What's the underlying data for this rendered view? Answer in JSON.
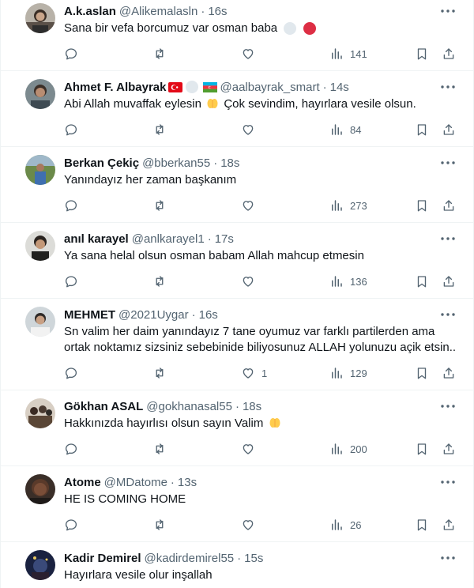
{
  "tweets": [
    {
      "name": "A.k.aslan",
      "handle": "@Alikemalasln",
      "time": "16s",
      "text": "Sana bir vefa borcumuz var osman baba",
      "replies": "",
      "retweets": "",
      "likes": "",
      "views": "141"
    },
    {
      "name": "Ahmet F. Albayrak",
      "handle": "@aalbayrak_smart",
      "time": "14s",
      "text_before": "Abi Allah muvaffak eylesin",
      "text_after": "Çok sevindim, hayırlara vesile olsun.",
      "replies": "",
      "retweets": "",
      "likes": "",
      "views": "84"
    },
    {
      "name": "Berkan Çekiç",
      "handle": "@bberkan55",
      "time": "18s",
      "text": "Yanındayız her zaman başkanım",
      "replies": "",
      "retweets": "",
      "likes": "",
      "views": "273"
    },
    {
      "name": "anıl karayel",
      "handle": "@anlkarayel1",
      "time": "17s",
      "text": "Ya sana helal olsun osman babam Allah mahcup etmesin",
      "replies": "",
      "retweets": "",
      "likes": "",
      "views": "136"
    },
    {
      "name": "MEHMET",
      "handle": "@2021Uygar",
      "time": "16s",
      "text": "Sn valim her daim yanındayız 7 tane oyumuz var farklı partilerden ama ortak noktamız sizsiniz sebebinide biliyosunuz ALLAH yolunuzu açik etsin..",
      "replies": "",
      "retweets": "",
      "likes": "1",
      "views": "129"
    },
    {
      "name": "Gökhan ASAL",
      "handle": "@gokhanasal55",
      "time": "18s",
      "text": "Hakkınızda hayırlısı olsun sayın Valim",
      "replies": "",
      "retweets": "",
      "likes": "",
      "views": "200"
    },
    {
      "name": "Atome",
      "handle": "@MDatome",
      "time": "13s",
      "text": "HE IS COMING HOME",
      "replies": "",
      "retweets": "",
      "likes": "",
      "views": "26"
    },
    {
      "name": "Kadir Demirel",
      "handle": "@kadirdemirel55",
      "time": "15s",
      "text": "Hayırlara vesile olur inşallah",
      "replies": "",
      "retweets": "",
      "likes": "",
      "views": ""
    }
  ],
  "separator": "·",
  "icons": [
    "more-icon",
    "reply-icon",
    "retweet-icon",
    "like-icon",
    "views-icon",
    "bookmark-icon",
    "share-icon"
  ],
  "colors": {
    "text": "#0f1419",
    "secondary": "#536471",
    "border": "#eff3f4",
    "flag_red": "#e30a17",
    "emoji_red": "#dd2e44",
    "emoji_white": "#e1e8ed",
    "hands_yellow": "#ffcc4d"
  }
}
